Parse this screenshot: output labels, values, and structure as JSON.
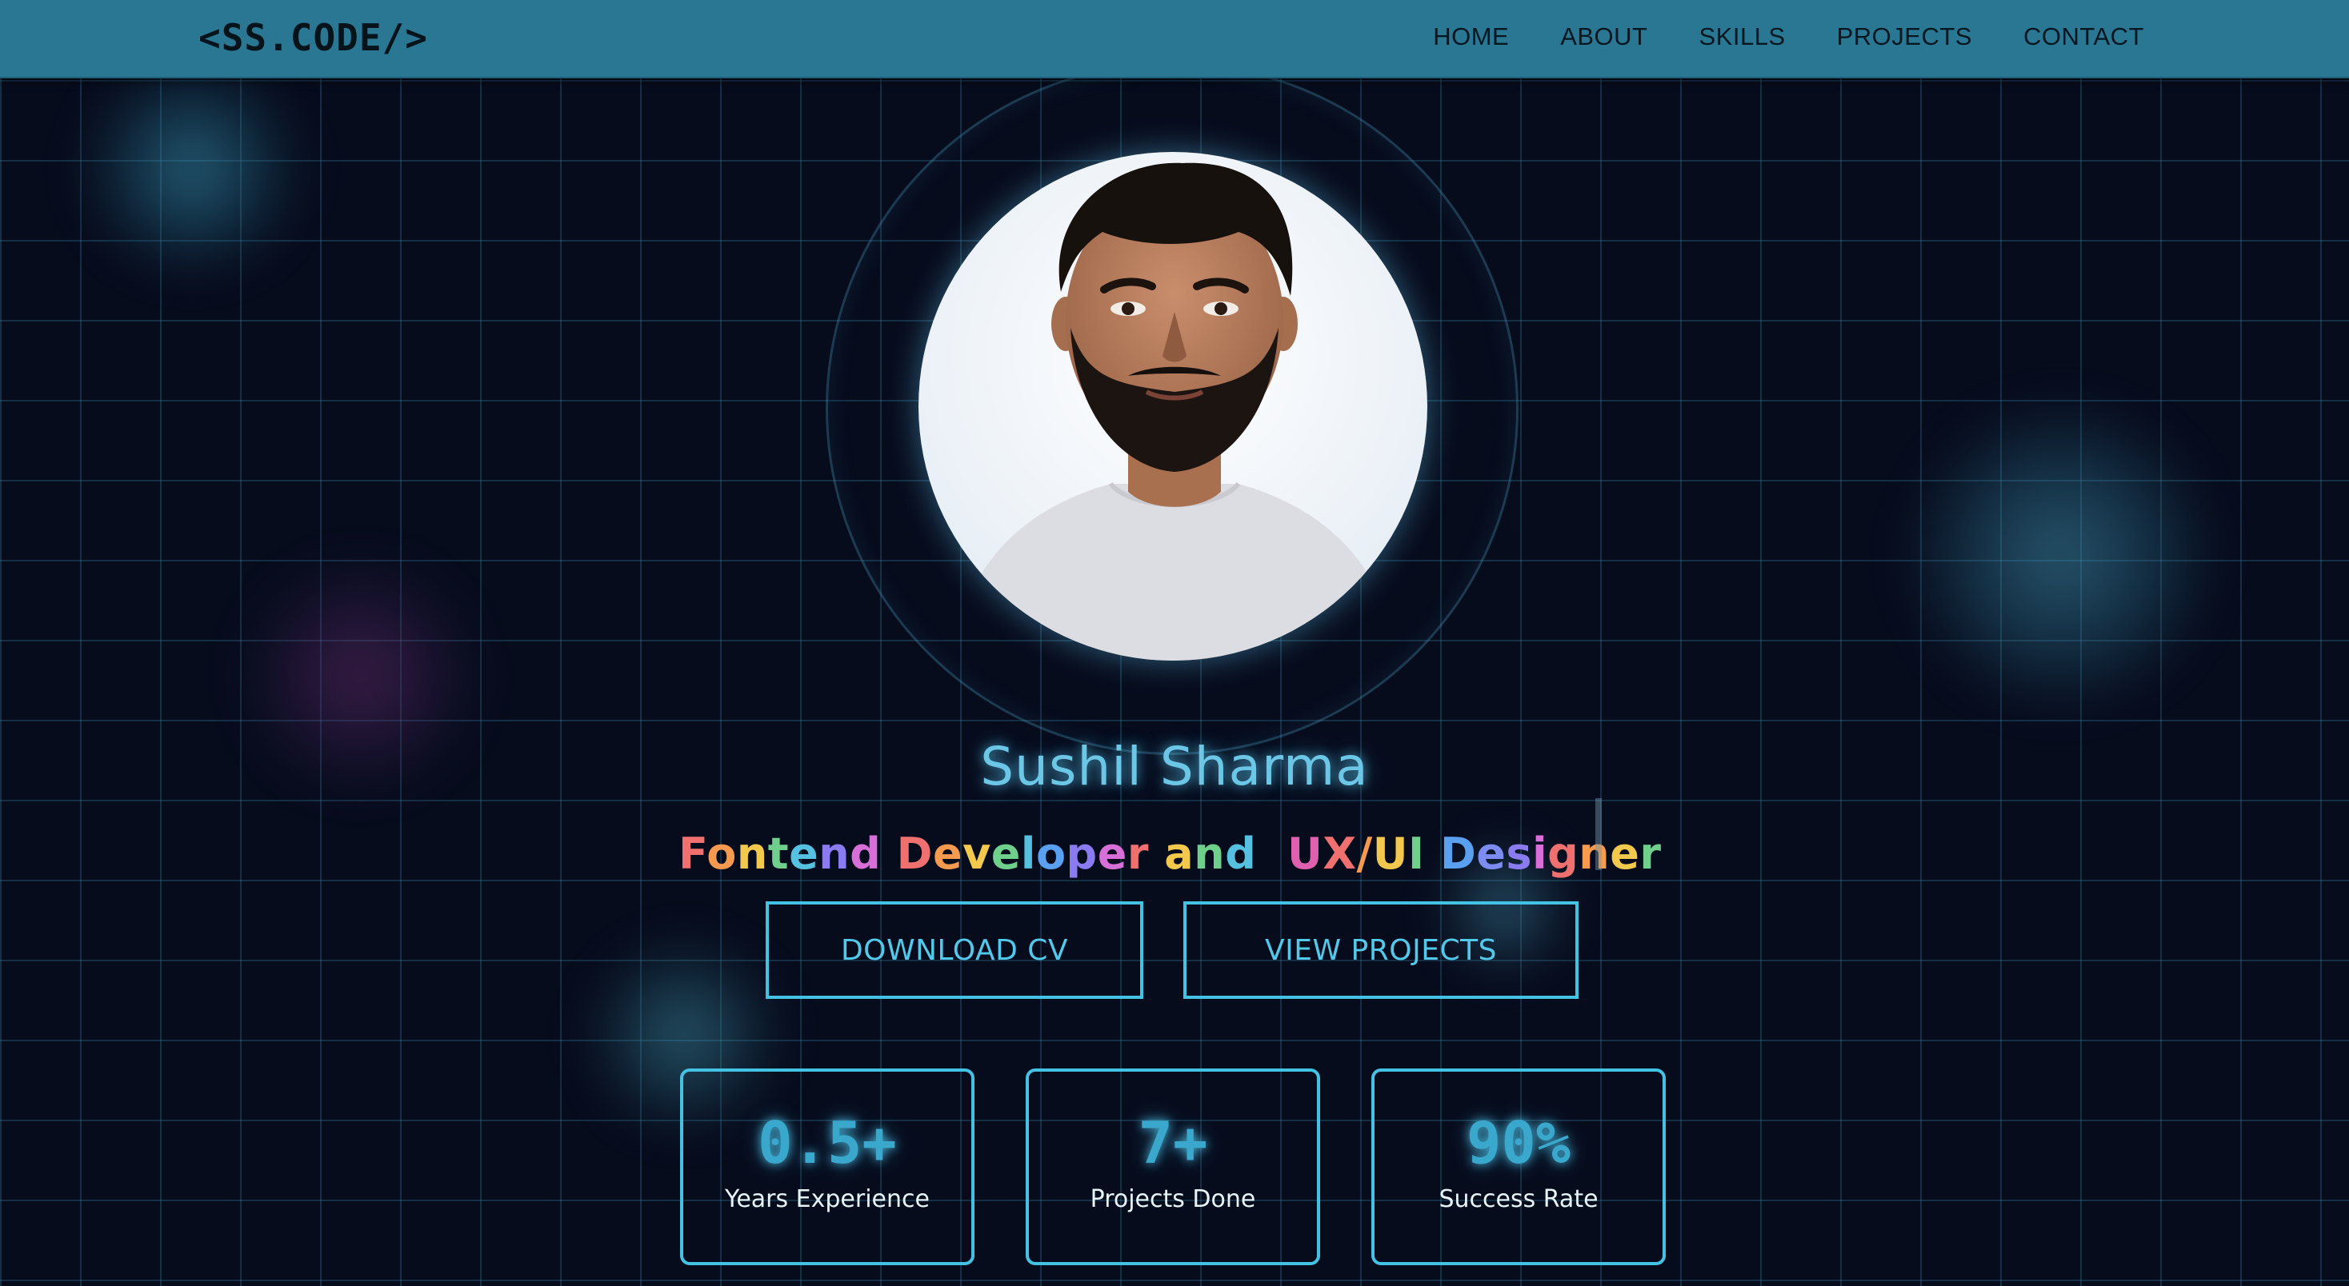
{
  "nav": {
    "logo": "<SS.CODE/>",
    "links": [
      "HOME",
      "ABOUT",
      "SKILLS",
      "PROJECTS",
      "CONTACT"
    ]
  },
  "hero": {
    "name": "Sushil Sharma",
    "tagline_words": [
      {
        "text": "Fontend",
        "colors": [
          "#f07070",
          "#f59a4e",
          "#f2c94c",
          "#6fd08c",
          "#56c0e0",
          "#8a7cf0",
          "#d86fd8"
        ]
      },
      {
        "text": "Developer",
        "colors": [
          "#f07070",
          "#f59a4e",
          "#f2c94c",
          "#6fd08c",
          "#56c0e0",
          "#5aa0f0",
          "#8a7cf0",
          "#d86fd8",
          "#f07070"
        ]
      },
      {
        "text": "and",
        "colors": [
          "#f2c94c",
          "#6fd08c",
          "#56c0e0"
        ]
      },
      {
        "text": "UX/UI",
        "colors": [
          "#e060b0",
          "#f07070",
          "#f59a4e",
          "#f2c94c",
          "#6fd08c"
        ]
      },
      {
        "text": "Designer",
        "colors": [
          "#5aa0f0",
          "#7c8cf0",
          "#8a7cf0",
          "#d86fd8",
          "#f07070",
          "#f59a4e",
          "#f2c94c",
          "#6fd08c"
        ]
      }
    ]
  },
  "buttons": {
    "download_cv": "DOWNLOAD CV",
    "view_projects": "VIEW PROJECTS"
  },
  "stats": [
    {
      "value": "0.5+",
      "label": "Years Experience"
    },
    {
      "value": "7+",
      "label": "Projects Done"
    },
    {
      "value": "90%",
      "label": "Success Rate"
    }
  ],
  "colors": {
    "nav_bg": "#2a7794",
    "accent": "#43c2e4",
    "name_glow": "#6cc6e6",
    "page_bg": "#070c1d"
  }
}
